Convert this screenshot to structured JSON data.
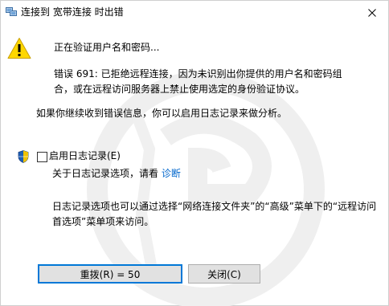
{
  "window": {
    "title": "连接到 宽带连接 时出错",
    "close_glyph": "✕"
  },
  "message": {
    "status": "正在验证用户名和密码...",
    "error_line1": "错误 691: 已拒绝远程连接，因为未识别出你提供的用户名和密码组",
    "error_line2": "合，或在远程访问服务器上禁止使用选定的身份验证协议。",
    "hint": "如果你继续收到错误信息，你可以启用日志记录来做分析。"
  },
  "logging": {
    "checkbox_label": "启用日志记录(E)",
    "checked": false,
    "about_prefix": "关于日志记录选项，请看 ",
    "diagnose_link": "诊断",
    "note_line1": "日志记录选项也可以通过选择“网络连接文件夹”的“高级”菜单下的“远程访问",
    "note_line2": "首选项”菜单项来访问。"
  },
  "buttons": {
    "redial": "重拨(R) = 50",
    "close": "关闭(C)"
  },
  "colors": {
    "warning_yellow": "#ffd700",
    "link_blue": "#0066cc",
    "focus_border": "#0078d7",
    "button_face": "#e1e1e1"
  }
}
